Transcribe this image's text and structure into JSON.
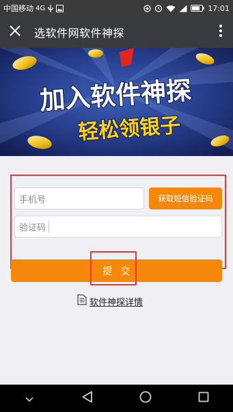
{
  "status_bar": {
    "carrier": "中国移动",
    "network": "4G",
    "time": "17:01",
    "icons": [
      "usb-icon",
      "image-icon",
      "battery-saver-icon",
      "alarm-icon",
      "wifi-icon",
      "signal-icon",
      "battery-icon"
    ]
  },
  "nav": {
    "title": "选软件网软件神探",
    "close_icon": "close-icon",
    "more_icon": "more-vertical-icon"
  },
  "banner": {
    "line1": "加入软件神探",
    "line2": "轻松领银子"
  },
  "form": {
    "phone_label": "手机号",
    "phone_value": "",
    "code_label": "验证码",
    "code_value": "",
    "sms_button": "获取短信验证码",
    "submit": "提交"
  },
  "detail_link": {
    "text": "软件神探详情",
    "icon": "document-icon"
  },
  "colors": {
    "accent": "#f5880a",
    "highlight": "#e53a3a",
    "navbar": "#393a3f",
    "background": "#efeff4"
  }
}
